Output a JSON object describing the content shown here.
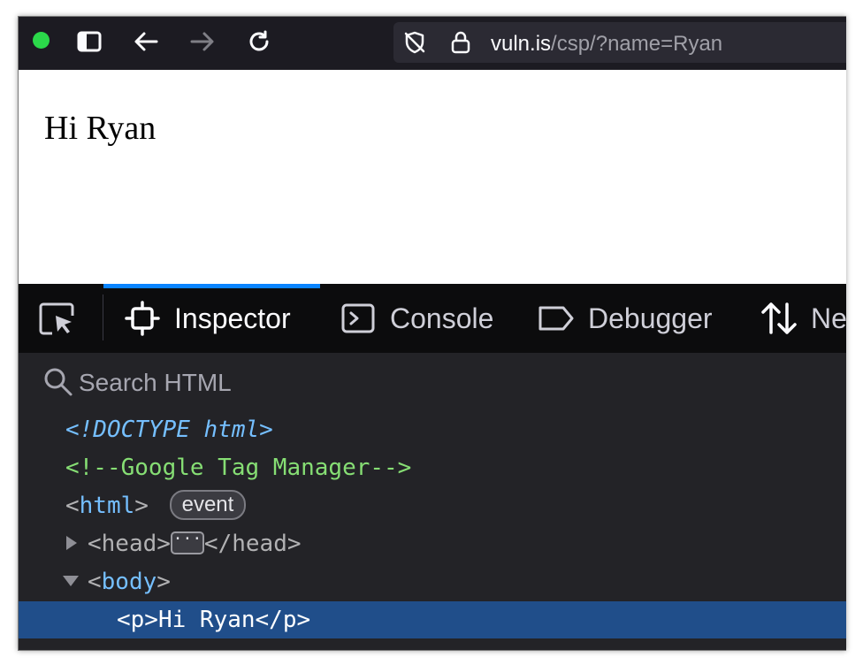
{
  "browser": {
    "url_host": "vuln.is",
    "url_path": "/csp/?name=Ryan"
  },
  "page": {
    "paragraph": "Hi Ryan"
  },
  "devtools": {
    "tabs": [
      {
        "label": "Inspector",
        "icon": "inspector-icon",
        "active": true
      },
      {
        "label": "Console",
        "icon": "console-icon",
        "active": false
      },
      {
        "label": "Debugger",
        "icon": "debugger-icon",
        "active": false
      },
      {
        "label": "Ne",
        "icon": "network-icon",
        "active": false
      }
    ],
    "search": {
      "placeholder": "Search HTML"
    },
    "tree": {
      "doctype": "<!DOCTYPE html>",
      "comment": "<!--Google Tag Manager-->",
      "html_open": "<",
      "html_tag": "html",
      "html_close": ">",
      "event_badge": "event",
      "head_open": "<head>",
      "head_ellipsis": "···",
      "head_close": "</head>",
      "body_open": "<",
      "body_tag": "body",
      "body_close": ">",
      "p_line": "<p>Hi Ryan</p>"
    }
  },
  "colors": {
    "accent": "#0a84ff",
    "selection": "#204e8a",
    "tag_blue": "#75bfff",
    "comment_green": "#86de74",
    "status_dot": "#2bd84a"
  }
}
